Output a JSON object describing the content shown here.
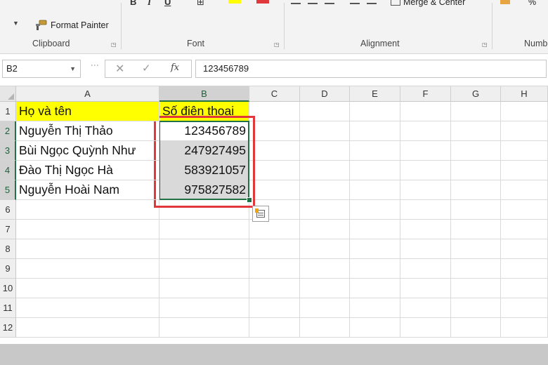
{
  "ribbon": {
    "format_painter_label": "Format Painter",
    "merge_center_label": "Merge & Center",
    "percent_glyph": "%",
    "groups": {
      "clipboard": "Clipboard",
      "font": "Font",
      "alignment": "Alignment",
      "number": "Numb"
    }
  },
  "formula_bar": {
    "name_box": "B2",
    "fx_label": "fx",
    "formula_value": "123456789"
  },
  "grid": {
    "columns": [
      "A",
      "B",
      "C",
      "D",
      "E",
      "F",
      "G",
      "H"
    ],
    "rows": [
      "1",
      "2",
      "3",
      "4",
      "5",
      "6",
      "7",
      "8",
      "9",
      "10",
      "11",
      "12"
    ],
    "cells": {
      "A1": "Họ và tên",
      "B1": "Số điện thoại",
      "A2": "Nguyễn Thị Thảo",
      "B2": "123456789",
      "A3": "Bùi Ngọc Quỳnh Như",
      "B3": "247927495",
      "A4": "Đào Thị Ngọc Hà",
      "B4": "583921057",
      "A5": "Nguyễn Hoài Nam",
      "B5": "975827582"
    }
  },
  "colors": {
    "header_fill": "#ffff00",
    "selection_green": "#217346",
    "highlight_red": "#e0383b"
  }
}
